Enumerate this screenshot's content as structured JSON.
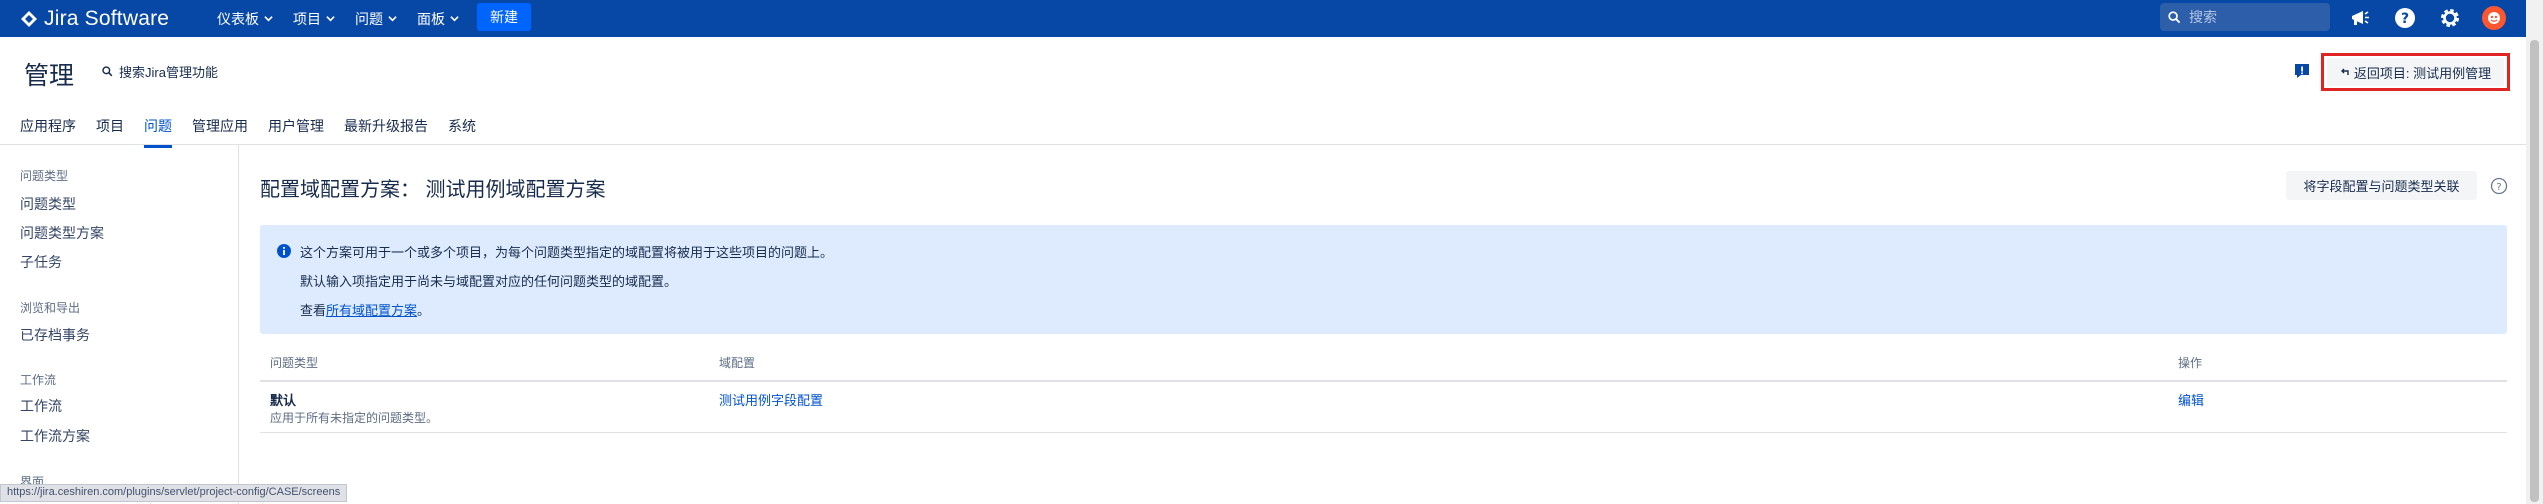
{
  "topbar": {
    "logo_text": "Jira Software",
    "nav": [
      {
        "label": "仪表板"
      },
      {
        "label": "项目"
      },
      {
        "label": "问题"
      },
      {
        "label": "面板"
      }
    ],
    "create_label": "新建",
    "search_placeholder": "搜索",
    "icons": [
      "notifications-icon",
      "help-icon",
      "settings-icon",
      "avatar"
    ],
    "brand_color": "#0747a6"
  },
  "admin": {
    "title": "管理",
    "search_label": "搜索Jira管理功能",
    "return_button_label": "返回项目: 测试用例管理",
    "tabs": [
      "应用程序",
      "项目",
      "问题",
      "管理应用",
      "用户管理",
      "最新升级报告",
      "系统"
    ],
    "active_tab": "问题"
  },
  "sidebar": {
    "groups": [
      {
        "heading": "问题类型",
        "items": [
          "问题类型",
          "问题类型方案",
          "子任务"
        ]
      },
      {
        "heading": "浏览和导出",
        "items": [
          "已存档事务"
        ]
      },
      {
        "heading": "工作流",
        "items": [
          "工作流",
          "工作流方案"
        ]
      },
      {
        "heading": "界面",
        "items": []
      }
    ]
  },
  "main": {
    "title": "配置域配置方案： 测试用例域配置方案",
    "associate_button_label": "将字段配置与问题类型关联",
    "info": {
      "line1": "这个方案可用于一个或多个项目，为每个问题类型指定的域配置将被用于这些项目的问题上。",
      "line2": "默认输入项指定用于尚未与域配置对应的任何问题类型的域配置。",
      "line3_prefix": "查看",
      "line3_link": "所有域配置方案",
      "line3_suffix": "。"
    },
    "table": {
      "headers": [
        "问题类型",
        "域配置",
        "操作"
      ],
      "rows": [
        {
          "issue_type": "默认",
          "issue_type_desc": "应用于所有未指定的问题类型。",
          "field_config": "测试用例字段配置",
          "action": "编辑"
        }
      ]
    }
  },
  "statusbar": {
    "url": "https://jira.ceshiren.com/plugins/servlet/project-config/CASE/screens"
  }
}
